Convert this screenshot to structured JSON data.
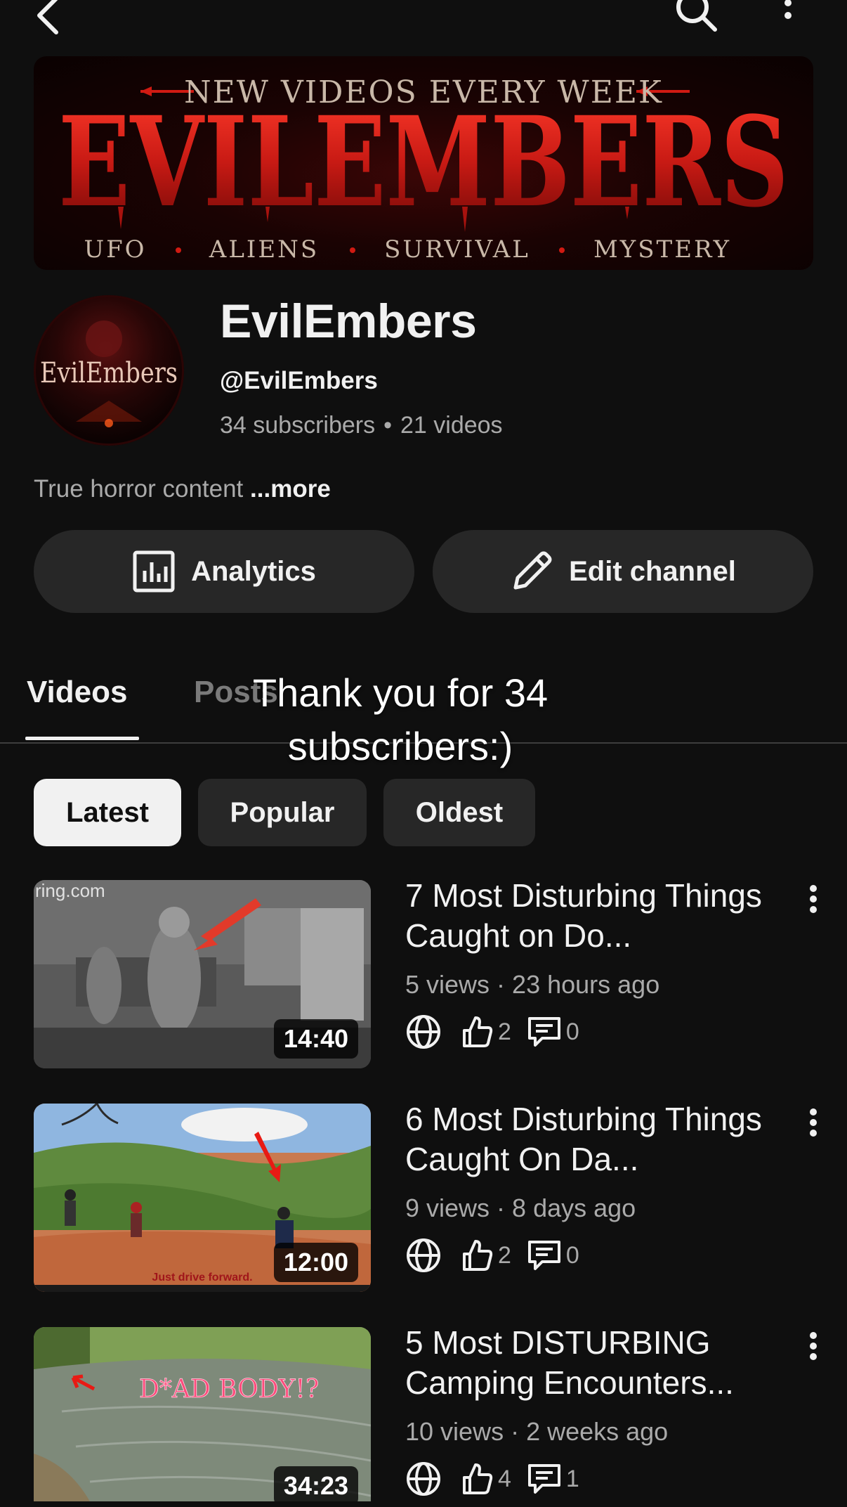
{
  "topbar": {
    "back_icon": "chevron-left-icon",
    "search_icon": "search-icon",
    "more_icon": "more-vert-icon"
  },
  "banner": {
    "tagline": "NEW VIDEOS EVERY WEEK",
    "title": "EVILEMBERS",
    "topics": [
      "UFO",
      "ALIENS",
      "SURVIVAL",
      "MYSTERY"
    ]
  },
  "channel": {
    "avatar_text": "EvilEmbers",
    "name": "EvilEmbers",
    "handle": "@EvilEmbers",
    "subscribers": "34 subscribers",
    "videos": "21 videos",
    "description": "True horror content",
    "more_label": "...more"
  },
  "actions": {
    "analytics_label": "Analytics",
    "edit_label": "Edit channel"
  },
  "tabs": [
    {
      "label": "Videos",
      "active": true
    },
    {
      "label": "Posts",
      "active": false
    }
  ],
  "overlay": {
    "line1": "Thank you for 34",
    "line2": "subscribers:)"
  },
  "chips": [
    {
      "label": "Latest",
      "selected": true
    },
    {
      "label": "Popular",
      "selected": false
    },
    {
      "label": "Oldest",
      "selected": false
    }
  ],
  "videos": [
    {
      "title": "7 Most Disturbing Things Caught on Do...",
      "views": "5 views",
      "age": "23 hours ago",
      "duration": "14:40",
      "likes": "2",
      "comments": "0",
      "thumb_overlay": "ring.com"
    },
    {
      "title": "6 Most Disturbing Things Caught On Da...",
      "views": "9 views",
      "age": "8 days ago",
      "duration": "12:00",
      "likes": "2",
      "comments": "0",
      "thumb_overlay": "Just drive forward."
    },
    {
      "title": "5 Most DISTURBING Camping Encounters...",
      "views": "10 views",
      "age": "2 weeks ago",
      "duration": "34:23",
      "likes": "4",
      "comments": "1",
      "thumb_overlay": "D*AD BODY!?"
    }
  ],
  "colors": {
    "background": "#0f0f0f",
    "surface": "#272727",
    "text_primary": "#f1f1f1",
    "text_secondary": "#aaaaaa",
    "banner_red": "#c81a14"
  }
}
